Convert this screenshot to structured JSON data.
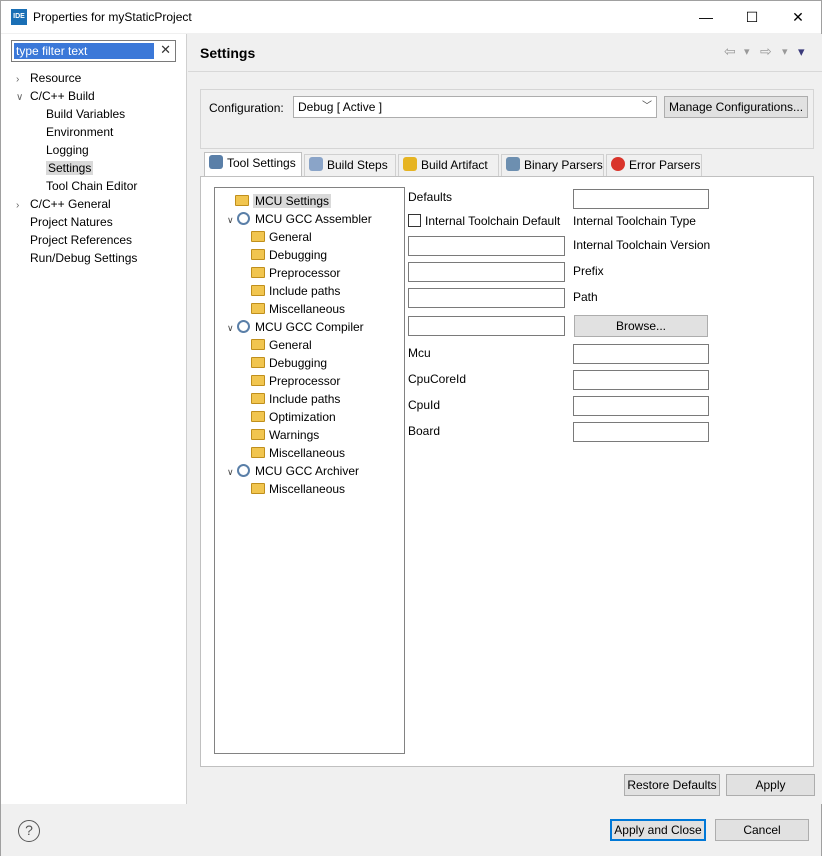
{
  "window": {
    "app_badge": "IDE",
    "title": "Properties for myStaticProject",
    "minimize": "—",
    "maximize": "☐",
    "close": "✕"
  },
  "filter": {
    "value": "type filter text",
    "clear": "✕"
  },
  "nav": {
    "items": [
      {
        "label": "Resource",
        "arrow": ">"
      },
      {
        "label": "C/C++ Build",
        "arrow": "v"
      },
      {
        "label": "Build Variables",
        "arrow": ""
      },
      {
        "label": "Environment",
        "arrow": ""
      },
      {
        "label": "Logging",
        "arrow": ""
      },
      {
        "label": "Settings",
        "arrow": ""
      },
      {
        "label": "Tool Chain Editor",
        "arrow": ""
      },
      {
        "label": "C/C++ General",
        "arrow": ">"
      },
      {
        "label": "Project Natures",
        "arrow": ""
      },
      {
        "label": "Project References",
        "arrow": ""
      },
      {
        "label": "Run/Debug Settings",
        "arrow": ""
      }
    ]
  },
  "page": {
    "title": "Settings",
    "back_icon": "⇦",
    "fwd_icon": "⇨",
    "dd_icon": "▾",
    "menu_icon": "▾"
  },
  "config": {
    "label": "Configuration:",
    "value": "Debug  [ Active ]",
    "manage": "Manage Configurations..."
  },
  "tabs": [
    {
      "label": "Tool Settings",
      "icon": "gear-icon",
      "color": "#5a7fa8"
    },
    {
      "label": "Build Steps",
      "icon": "hammer-icon",
      "color": "#8aa4c8"
    },
    {
      "label": "Build Artifact",
      "icon": "trophy-icon",
      "color": "#e6b422"
    },
    {
      "label": "Binary Parsers",
      "icon": "binary-icon",
      "color": "#6d8fb0"
    },
    {
      "label": "Error Parsers",
      "icon": "error-icon",
      "color": "#d9342b"
    }
  ],
  "tree": [
    {
      "label": "MCU Settings"
    },
    {
      "label": "MCU GCC Assembler",
      "toggle": "v"
    },
    {
      "label": "General"
    },
    {
      "label": "Debugging"
    },
    {
      "label": "Preprocessor"
    },
    {
      "label": "Include paths"
    },
    {
      "label": "Miscellaneous"
    },
    {
      "label": "MCU GCC Compiler",
      "toggle": "v"
    },
    {
      "label": "General"
    },
    {
      "label": "Debugging"
    },
    {
      "label": "Preprocessor"
    },
    {
      "label": "Include paths"
    },
    {
      "label": "Optimization"
    },
    {
      "label": "Warnings"
    },
    {
      "label": "Miscellaneous"
    },
    {
      "label": "MCU GCC Archiver",
      "toggle": "v"
    },
    {
      "label": "Miscellaneous"
    }
  ],
  "form": {
    "defaults": "Defaults",
    "internal_default": "Internal Toolchain Default",
    "internal_type": "Internal Toolchain Type",
    "internal_version": "Internal Toolchain Version",
    "prefix": "Prefix",
    "path": "Path",
    "browse": "Browse...",
    "mcu": "Mcu",
    "cpucoreid": "CpuCoreId",
    "cpuid": "CpuId",
    "board": "Board"
  },
  "buttons": {
    "restore": "Restore Defaults",
    "apply": "Apply",
    "apply_close": "Apply and Close",
    "cancel": "Cancel",
    "help": "?"
  }
}
